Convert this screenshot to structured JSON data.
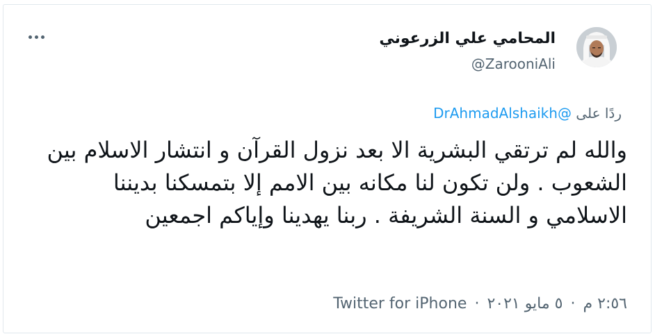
{
  "author": {
    "display_name": "المحامي علي الزرعوني",
    "handle": "@ZarooniAli"
  },
  "menu": {
    "more_icon": "ellipsis-icon"
  },
  "reply": {
    "prefix": "ردًا على",
    "target": "@DrAhmadAlshaikh"
  },
  "tweet": {
    "text": "والله لم ترتقي البشرية الا بعد نزول القرآن و انتشار الاسلام بين الشعوب . ولن تكون لنا مكانه بين الامم إلا بتمسكنا بديننا الاسلامي و السنة الشريفة . ربنا يهدينا وإياكم اجمعين"
  },
  "meta": {
    "time": "٢:٥٦ م",
    "date": "٥ مايو ٢٠٢١",
    "separator": "·",
    "source": "Twitter for iPhone"
  },
  "colors": {
    "link": "#1d9bf0",
    "secondary_text": "#536471",
    "primary_text": "#0f1419",
    "border": "#e1e8ed"
  }
}
